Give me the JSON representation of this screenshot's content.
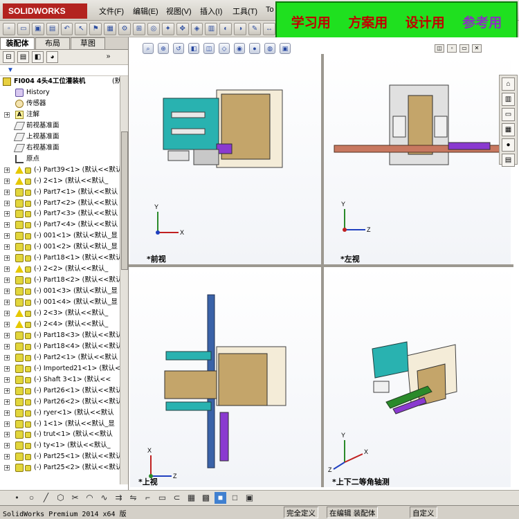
{
  "app": {
    "logo": "SOLIDWORKS",
    "menus": [
      "文件(F)",
      "编辑(E)",
      "视图(V)",
      "插入(I)",
      "工具(T)",
      "To"
    ]
  },
  "banner": {
    "items": [
      "学习用",
      "方案用",
      "设计用",
      "参考用"
    ],
    "colors": [
      "#c00000",
      "#c00000",
      "#c00000",
      "#8a30c0"
    ],
    "background": "#1fe01f"
  },
  "panel_tabs": [
    "装配体",
    "布局",
    "草图"
  ],
  "tree": {
    "root": "FI004 4头4工位灌装机",
    "root_suffix": "(默认<默认",
    "items": [
      {
        "label": "History",
        "icon": "history-icon",
        "expand": false
      },
      {
        "label": "传感器",
        "icon": "sensor-icon",
        "expand": false
      },
      {
        "label": "注解",
        "icon": "annotation-icon",
        "expand": true
      },
      {
        "label": "前视基准面",
        "icon": "plane-icon",
        "expand": false
      },
      {
        "label": "上视基准面",
        "icon": "plane-icon",
        "expand": false
      },
      {
        "label": "右视基准面",
        "icon": "plane-icon",
        "expand": false
      },
      {
        "label": "原点",
        "icon": "origin-icon",
        "expand": false
      },
      {
        "label": "(-) Part39<1> (默认<<默认",
        "icon": "warning-icon",
        "expand": true
      },
      {
        "label": "(-) 2<1> (默认<<默认_",
        "icon": "warning-icon",
        "expand": true
      },
      {
        "label": "(-) Part7<1> (默认<<默认",
        "icon": "part-icon",
        "expand": true
      },
      {
        "label": "(-) Part7<2> (默认<<默认",
        "icon": "part-icon",
        "expand": true
      },
      {
        "label": "(-) Part7<3> (默认<<默认",
        "icon": "part-icon",
        "expand": true
      },
      {
        "label": "(-) Part7<4> (默认<<默认",
        "icon": "part-icon",
        "expand": true
      },
      {
        "label": "(-) 001<1> (默认<默认_显",
        "icon": "part-icon",
        "expand": true
      },
      {
        "label": "(-) 001<2> (默认<默认_显",
        "icon": "part-icon",
        "expand": true
      },
      {
        "label": "(-) Part18<1> (默认<<默认",
        "icon": "part-icon",
        "expand": true
      },
      {
        "label": "(-) 2<2> (默认<<默认_",
        "icon": "warning-icon",
        "expand": true
      },
      {
        "label": "(-) Part18<2> (默认<<默认",
        "icon": "part-icon",
        "expand": true
      },
      {
        "label": "(-) 001<3> (默认<默认_显",
        "icon": "part-icon",
        "expand": true
      },
      {
        "label": "(-) 001<4> (默认<默认_显",
        "icon": "part-icon",
        "expand": true
      },
      {
        "label": "(-) 2<3> (默认<<默认_",
        "icon": "warning-icon",
        "expand": true
      },
      {
        "label": "(-) 2<4> (默认<<默认_",
        "icon": "warning-icon",
        "expand": true
      },
      {
        "label": "(-) Part18<3> (默认<<默认",
        "icon": "part-icon",
        "expand": true
      },
      {
        "label": "(-) Part18<4> (默认<<默认",
        "icon": "part-icon",
        "expand": true
      },
      {
        "label": "(-) Part2<1> (默认<<默认",
        "icon": "part-icon",
        "expand": true
      },
      {
        "label": "(-) Imported21<1> (默认<",
        "icon": "part-icon",
        "expand": true
      },
      {
        "label": "(-) Shaft 3<1> (默认<<",
        "icon": "part-icon",
        "expand": true
      },
      {
        "label": "(-) Part26<1> (默认<<默认",
        "icon": "part-icon",
        "expand": true
      },
      {
        "label": "(-) Part26<2> (默认<<默认",
        "icon": "part-icon",
        "expand": true
      },
      {
        "label": "(-) ryer<1> (默认<<默认",
        "icon": "part-icon",
        "expand": true
      },
      {
        "label": "(-) 1<1> (默认<<默认_显",
        "icon": "part-icon",
        "expand": true
      },
      {
        "label": "(-) trut<1> (默认<<默认",
        "icon": "part-icon",
        "expand": true
      },
      {
        "label": "(-) ty<1> (默认<<默认_",
        "icon": "part-icon",
        "expand": true
      },
      {
        "label": "(-) Part25<1> (默认<<默认",
        "icon": "part-icon",
        "expand": true
      },
      {
        "label": "(-) Part25<2> (默认<<默认",
        "icon": "part-icon",
        "expand": true
      }
    ]
  },
  "viewports": [
    {
      "label": "*前视"
    },
    {
      "label": "*左视"
    },
    {
      "label": "*上视"
    },
    {
      "label": "*上下二等角轴测"
    }
  ],
  "status": {
    "product": "SolidWorks Premium 2014 x64 版",
    "fully_defined": "完全定义",
    "editing": "在编辑 装配体",
    "custom": "自定义"
  }
}
